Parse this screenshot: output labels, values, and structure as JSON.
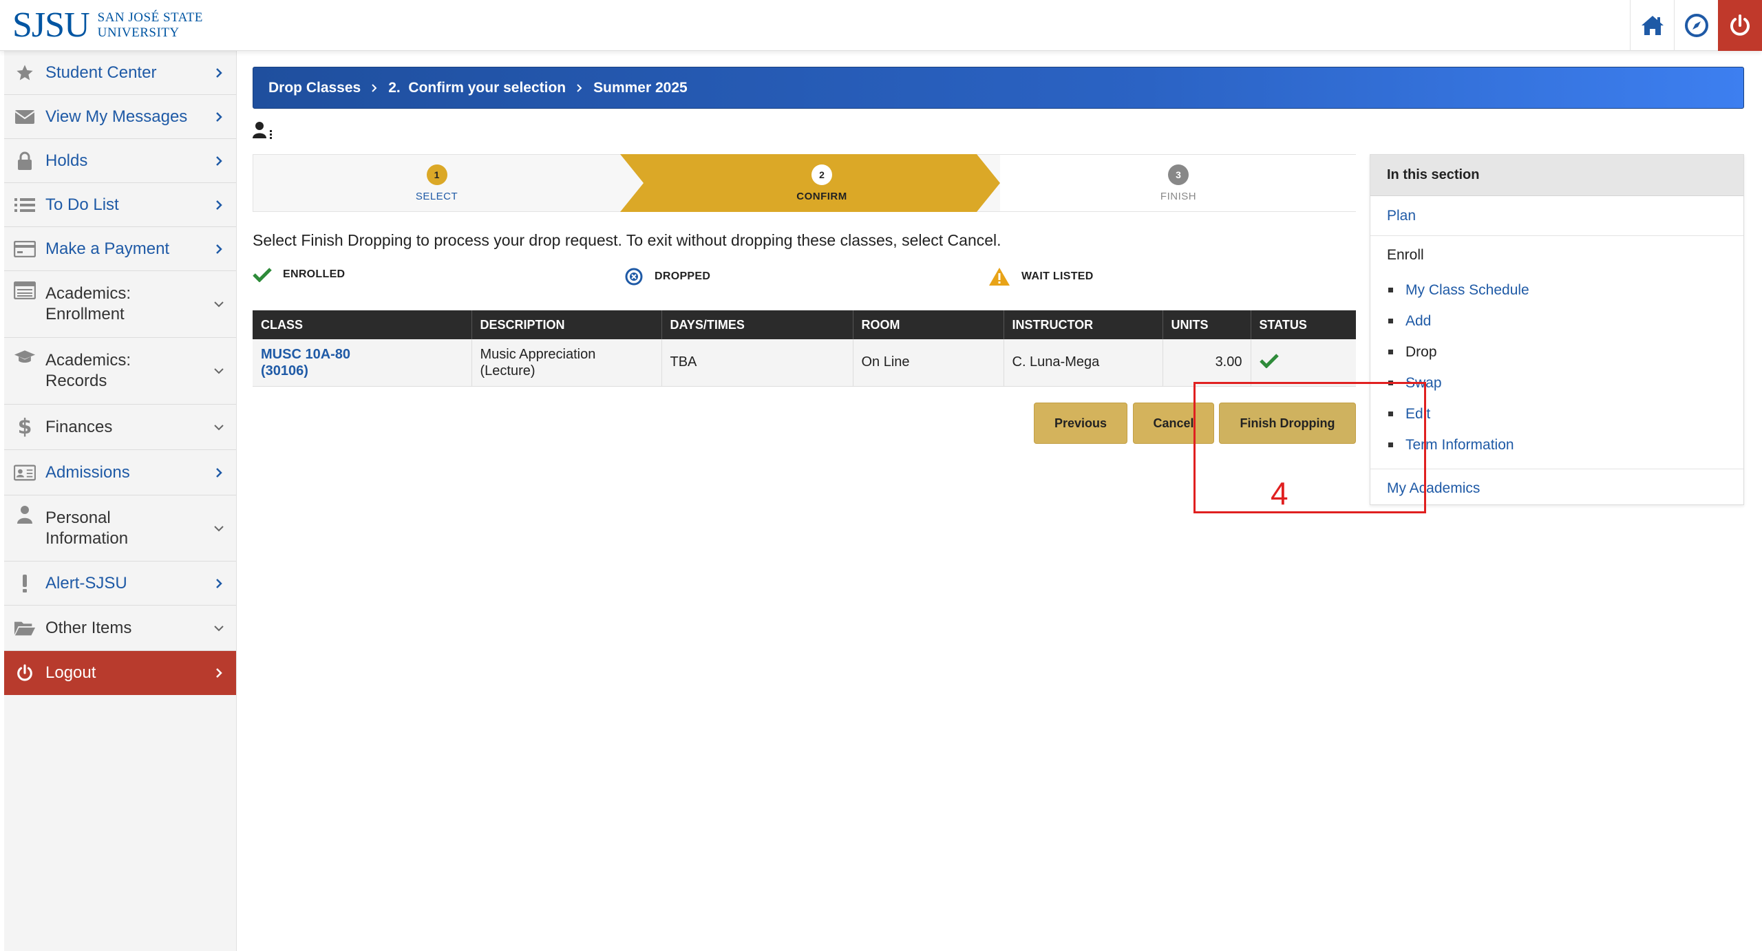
{
  "header": {
    "logo_mark": "SJSU",
    "logo_line1": "SAN JOSÉ STATE",
    "logo_line2": "UNIVERSITY",
    "icons": [
      "home-icon",
      "compass-icon",
      "power-icon"
    ]
  },
  "sidebar": {
    "items": [
      {
        "label": "Student Center",
        "icon": "star-icon",
        "chevron": "right"
      },
      {
        "label": "View My Messages",
        "icon": "envelope-icon",
        "chevron": "right"
      },
      {
        "label": "Holds",
        "icon": "lock-icon",
        "chevron": "right"
      },
      {
        "label": "To Do List",
        "icon": "list-icon",
        "chevron": "right"
      },
      {
        "label": "Make a Payment",
        "icon": "credit-card-icon",
        "chevron": "right"
      },
      {
        "label": "Academics: Enrollment",
        "line1": "Academics:",
        "line2": "Enrollment",
        "icon": "table-icon",
        "chevron": "down"
      },
      {
        "label": "Academics: Records",
        "line1": "Academics:",
        "line2": "Records",
        "icon": "graduation-cap-icon",
        "chevron": "down"
      },
      {
        "label": "Finances",
        "icon": "dollar-icon",
        "chevron": "down"
      },
      {
        "label": "Admissions",
        "icon": "id-card-icon",
        "chevron": "right"
      },
      {
        "label": "Personal Information",
        "line1": "Personal",
        "line2": "Information",
        "icon": "user-icon",
        "chevron": "down"
      },
      {
        "label": "Alert-SJSU",
        "icon": "exclamation-icon",
        "chevron": "right"
      },
      {
        "label": "Other Items",
        "icon": "folder-icon",
        "chevron": "down"
      },
      {
        "label": "Logout",
        "icon": "power-icon",
        "chevron": "right"
      }
    ]
  },
  "breadcrumb": {
    "items": [
      "Drop Classes",
      "2.  Confirm your selection",
      "Summer 2025"
    ]
  },
  "steps": [
    {
      "num": "1",
      "label": "SELECT",
      "state": "done"
    },
    {
      "num": "2",
      "label": "CONFIRM",
      "state": "active"
    },
    {
      "num": "3",
      "label": "FINISH",
      "state": "upcoming"
    }
  ],
  "instructions": "Select Finish Dropping to process your drop request. To exit without dropping these classes, select Cancel.",
  "legend": [
    {
      "label": "ENROLLED",
      "icon": "check-icon",
      "color": "#2e8b3a"
    },
    {
      "label": "DROPPED",
      "icon": "x-circle-icon",
      "color": "#1f5aa6"
    },
    {
      "label": "WAIT LISTED",
      "icon": "warning-icon",
      "color": "#e8a317"
    }
  ],
  "table": {
    "headers": [
      "CLASS",
      "DESCRIPTION",
      "DAYS/TIMES",
      "ROOM",
      "INSTRUCTOR",
      "UNITS",
      "STATUS"
    ],
    "rows": [
      {
        "class_line1": "MUSC 10A-80",
        "class_line2": "(30106)",
        "description_line1": "Music Appreciation",
        "description_line2": "(Lecture)",
        "days_times": "TBA",
        "room": "On Line",
        "instructor": "C. Luna-Mega",
        "units": "3.00",
        "status": "enrolled"
      }
    ]
  },
  "buttons": {
    "previous": "Previous",
    "cancel": "Cancel",
    "finish": "Finish Dropping"
  },
  "section_panel": {
    "title": "In this section",
    "plan": "Plan",
    "enroll": "Enroll",
    "enroll_items": [
      "My Class Schedule",
      "Add",
      "Drop",
      "Swap",
      "Edit",
      "Term Information"
    ],
    "my_academics": "My Academics"
  },
  "annotation": {
    "label": "4",
    "color": "#e02020"
  }
}
